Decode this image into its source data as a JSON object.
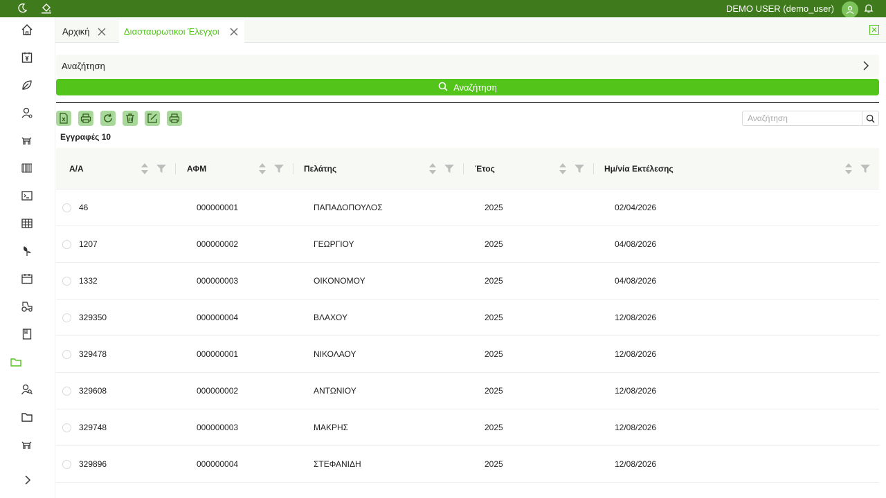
{
  "header": {
    "user": "DEMO USER (demo_user)",
    "icons": [
      "moon-icon",
      "paint-bucket-icon",
      "user-avatar-icon",
      "bell-icon"
    ]
  },
  "sidebar": {
    "icons": [
      "home-icon",
      "yen-document-icon",
      "leaf-icon",
      "user-settings-icon",
      "cow-icon",
      "barcode-icon",
      "terminal-icon",
      "table-icon",
      "plant-icon",
      "calendar-icon",
      "tractor-icon",
      "book-icon",
      "folder-open-icon",
      "user-search-icon",
      "folder-icon",
      "cow-icon-2",
      "expand-chevron-icon"
    ]
  },
  "tabs": [
    {
      "label": "Αρχική"
    },
    {
      "label": "Διασταυρωτικοι Έλεγχοι"
    }
  ],
  "search_panel": {
    "title": "Αναζήτηση",
    "button_label": "Αναζήτηση"
  },
  "toolbar": {
    "buttons": [
      "excel-export",
      "print",
      "refresh",
      "delete",
      "edit",
      "print-2"
    ],
    "search_placeholder": "Αναζήτηση"
  },
  "records_label": "Εγγραφές 10",
  "table": {
    "columns": [
      "Α/Α",
      "ΑΦΜ",
      "Πελάτης",
      "Έτος",
      "Ημ/νία Εκτέλεσης"
    ],
    "rows": [
      [
        "46",
        "000000001",
        "ΠΑΠΑΔΟΠΟΥΛΟΣ",
        "2025",
        "02/04/2026"
      ],
      [
        "1207",
        "000000002",
        "ΓΕΩΡΓΙΟΥ",
        "2025",
        "04/08/2026"
      ],
      [
        "1332",
        "000000003",
        "ΟΙΚΟΝΟΜΟΥ",
        "2025",
        "04/08/2026"
      ],
      [
        "329350",
        "000000004",
        "ΒΛΑΧΟΥ",
        "2025",
        "12/08/2026"
      ],
      [
        "329478",
        "000000001",
        "ΝΙΚΟΛΑΟΥ",
        "2025",
        "12/08/2026"
      ],
      [
        "329608",
        "000000002",
        "ΑΝΤΩΝΙΟΥ",
        "2025",
        "12/08/2026"
      ],
      [
        "329748",
        "000000003",
        "ΜΑΚΡΗΣ",
        "2025",
        "12/08/2026"
      ],
      [
        "329896",
        "000000004",
        "ΣΤΕΦΑΝΙΔΗ",
        "2025",
        "12/08/2026"
      ]
    ]
  },
  "colors": {
    "topbar": "#3f7a1c",
    "accent": "#52c41a",
    "tool_button": "#a8d89a"
  }
}
